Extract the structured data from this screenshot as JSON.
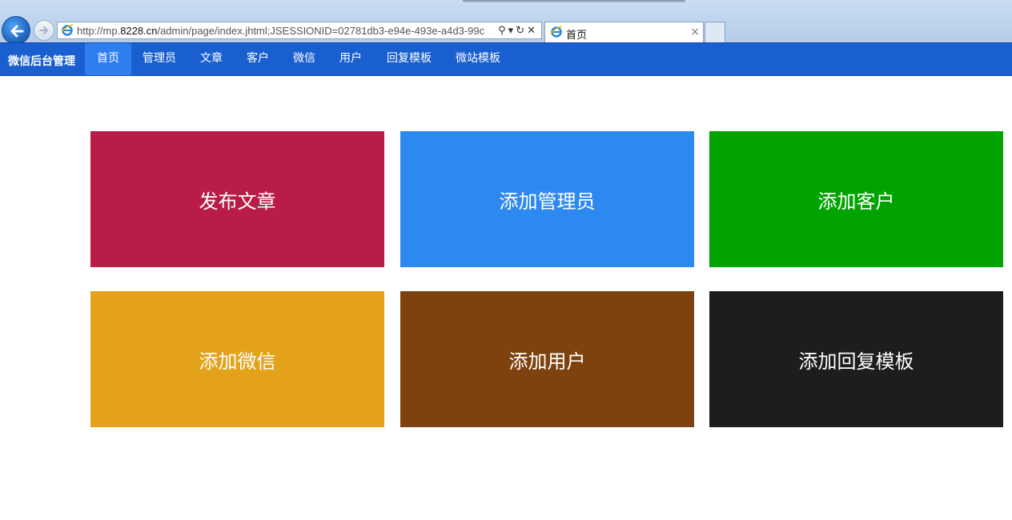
{
  "browser": {
    "url_prefix": "http://mp.",
    "url_domain": "8228.cn",
    "url_rest": "/admin/page/index.jhtml;JSESSIONID=02781db3-e94e-493e-a4d3-99c",
    "addr_tools": "⚲▾↻✕",
    "tab_title": "首页",
    "tab_close": "×"
  },
  "nav": {
    "brand": "微信后台管理",
    "items": [
      "首页",
      "管理员",
      "文章",
      "客户",
      "微信",
      "用户",
      "回复模板",
      "微站模板"
    ],
    "active": "首页",
    "color": "#1a5fd0",
    "active_color": "#2e7ef0"
  },
  "tiles": [
    {
      "label": "发布文章",
      "color": "#b91d47"
    },
    {
      "label": "添加管理员",
      "color": "#2d89ef"
    },
    {
      "label": "添加客户",
      "color": "#00a300"
    },
    {
      "label": "添加微信",
      "color": "#e3a21a"
    },
    {
      "label": "添加用户",
      "color": "#7e420f"
    },
    {
      "label": "添加回复模板",
      "color": "#1d1d1d"
    }
  ]
}
